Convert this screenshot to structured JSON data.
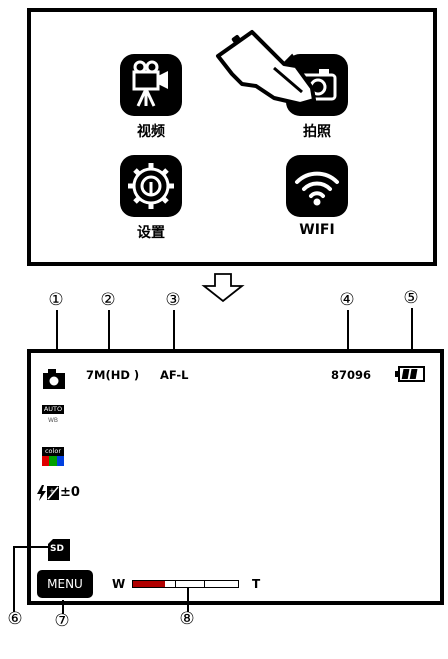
{
  "menu": {
    "items": [
      {
        "label": "视频",
        "icon": "video-camera-icon"
      },
      {
        "label": "拍照",
        "icon": "camera-icon"
      },
      {
        "label": "设置",
        "icon": "gear-icon"
      },
      {
        "label": "WIFI",
        "icon": "wifi-icon"
      }
    ]
  },
  "callouts": [
    "①",
    "②",
    "③",
    "④",
    "⑤",
    "⑥",
    "⑦",
    "⑧"
  ],
  "viewfinder": {
    "resolution": "7M(HD )",
    "focus_mode": "AF-L",
    "shots_remaining": "87096",
    "white_balance": "AUTO",
    "white_balance_sub": "WB",
    "color_mode": "color",
    "exposure": "±0",
    "storage": "SD",
    "menu_label": "MENU",
    "zoom_wide": "W",
    "zoom_tele": "T",
    "zoom_level": 0.3,
    "battery_icon": "battery-icon"
  },
  "colors": {
    "zoom_fill": "#b00000"
  }
}
